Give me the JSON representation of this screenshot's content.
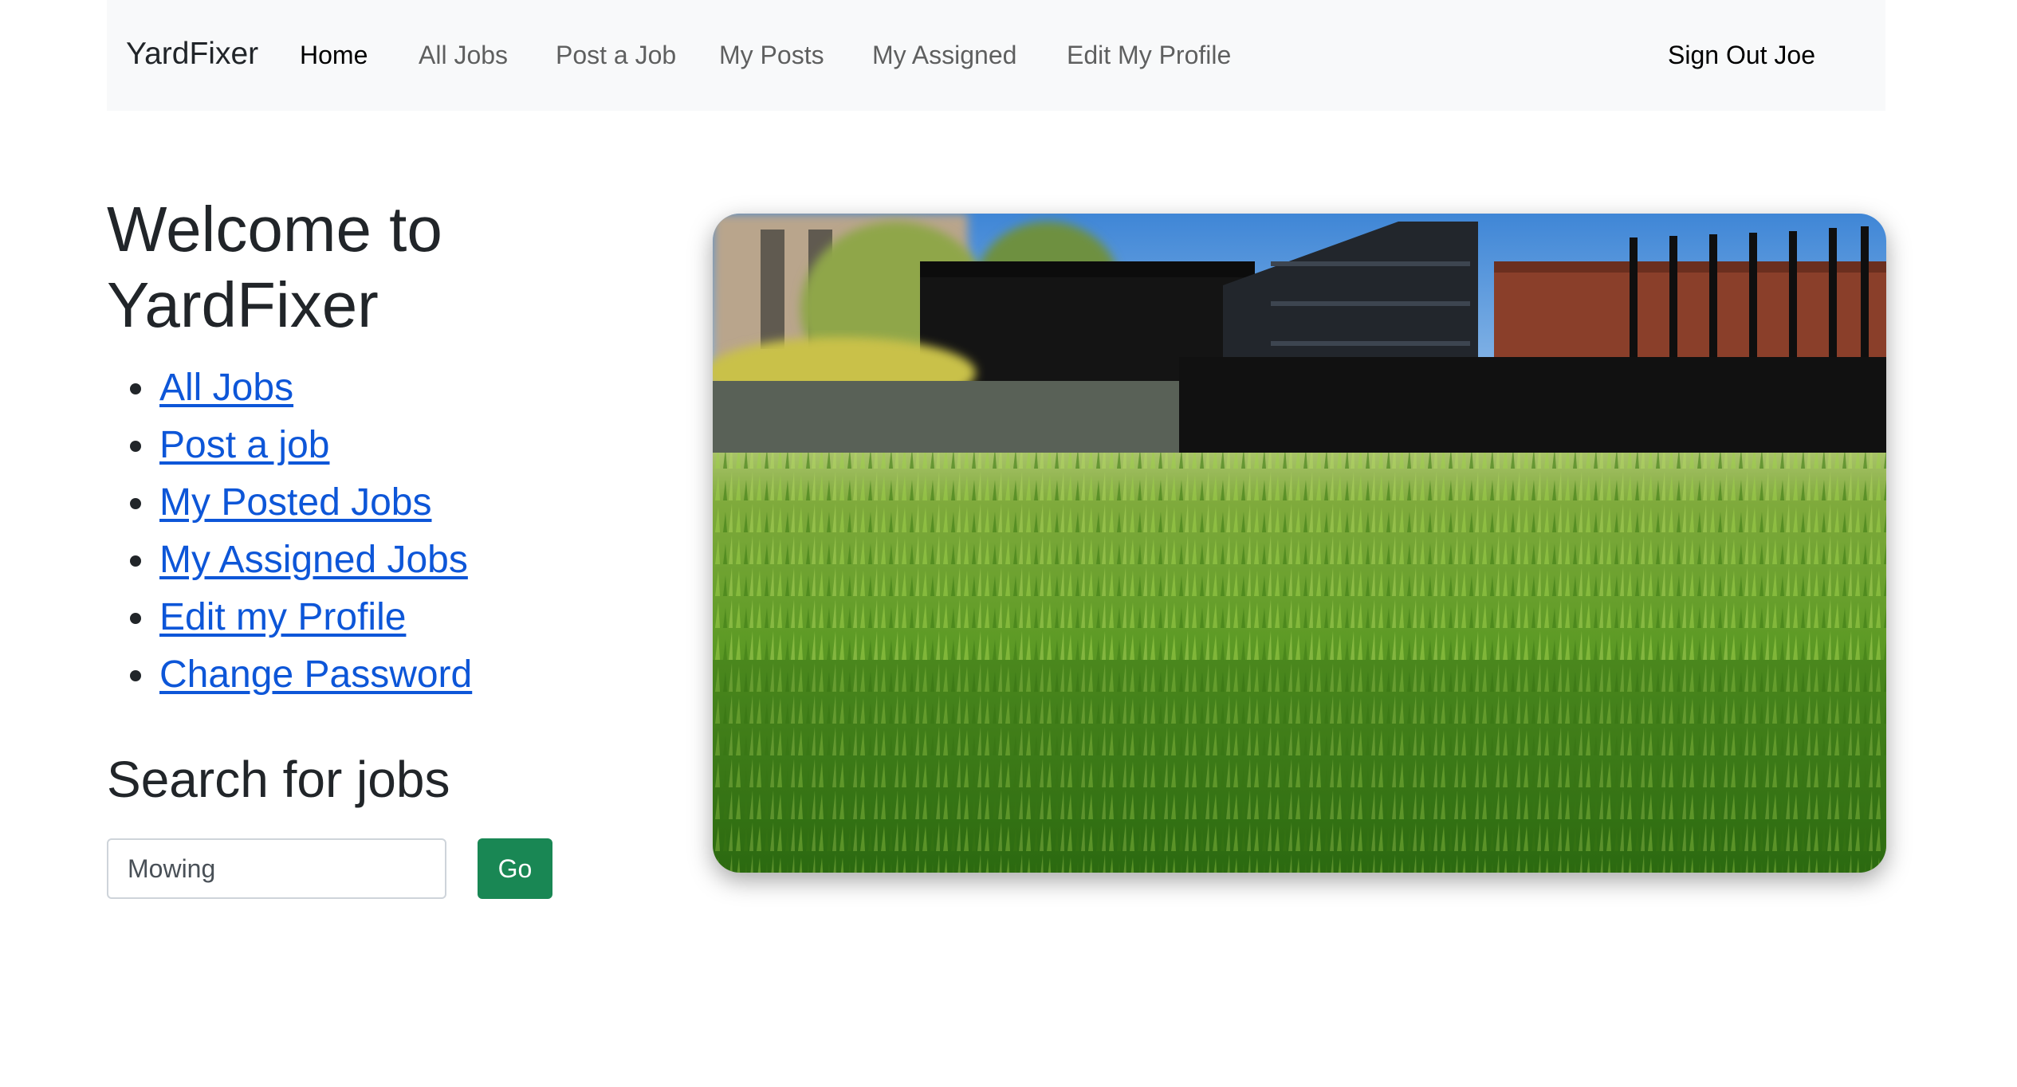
{
  "nav": {
    "brand": "YardFixer",
    "links": [
      {
        "label": "Home"
      },
      {
        "label": "All Jobs"
      },
      {
        "label": "Post a Job"
      },
      {
        "label": "My Posts"
      },
      {
        "label": "My Assigned"
      },
      {
        "label": "Edit My Profile"
      }
    ],
    "signout": "Sign Out Joe"
  },
  "main": {
    "welcome_title": "Welcome to YardFixer",
    "links": [
      {
        "label": "All Jobs"
      },
      {
        "label": "Post a job"
      },
      {
        "label": "My Posted Jobs"
      },
      {
        "label": "My Assigned Jobs"
      },
      {
        "label": "Edit my Profile"
      },
      {
        "label": "Change Password"
      }
    ],
    "search": {
      "title": "Search for jobs",
      "value": "Mowing",
      "button_label": "Go"
    }
  },
  "hero_image": {
    "subject": "lawn-grass-photo"
  },
  "colors": {
    "navbar_bg": "#f8f9fa",
    "link": "#0d56d8",
    "button_bg": "#198754"
  }
}
